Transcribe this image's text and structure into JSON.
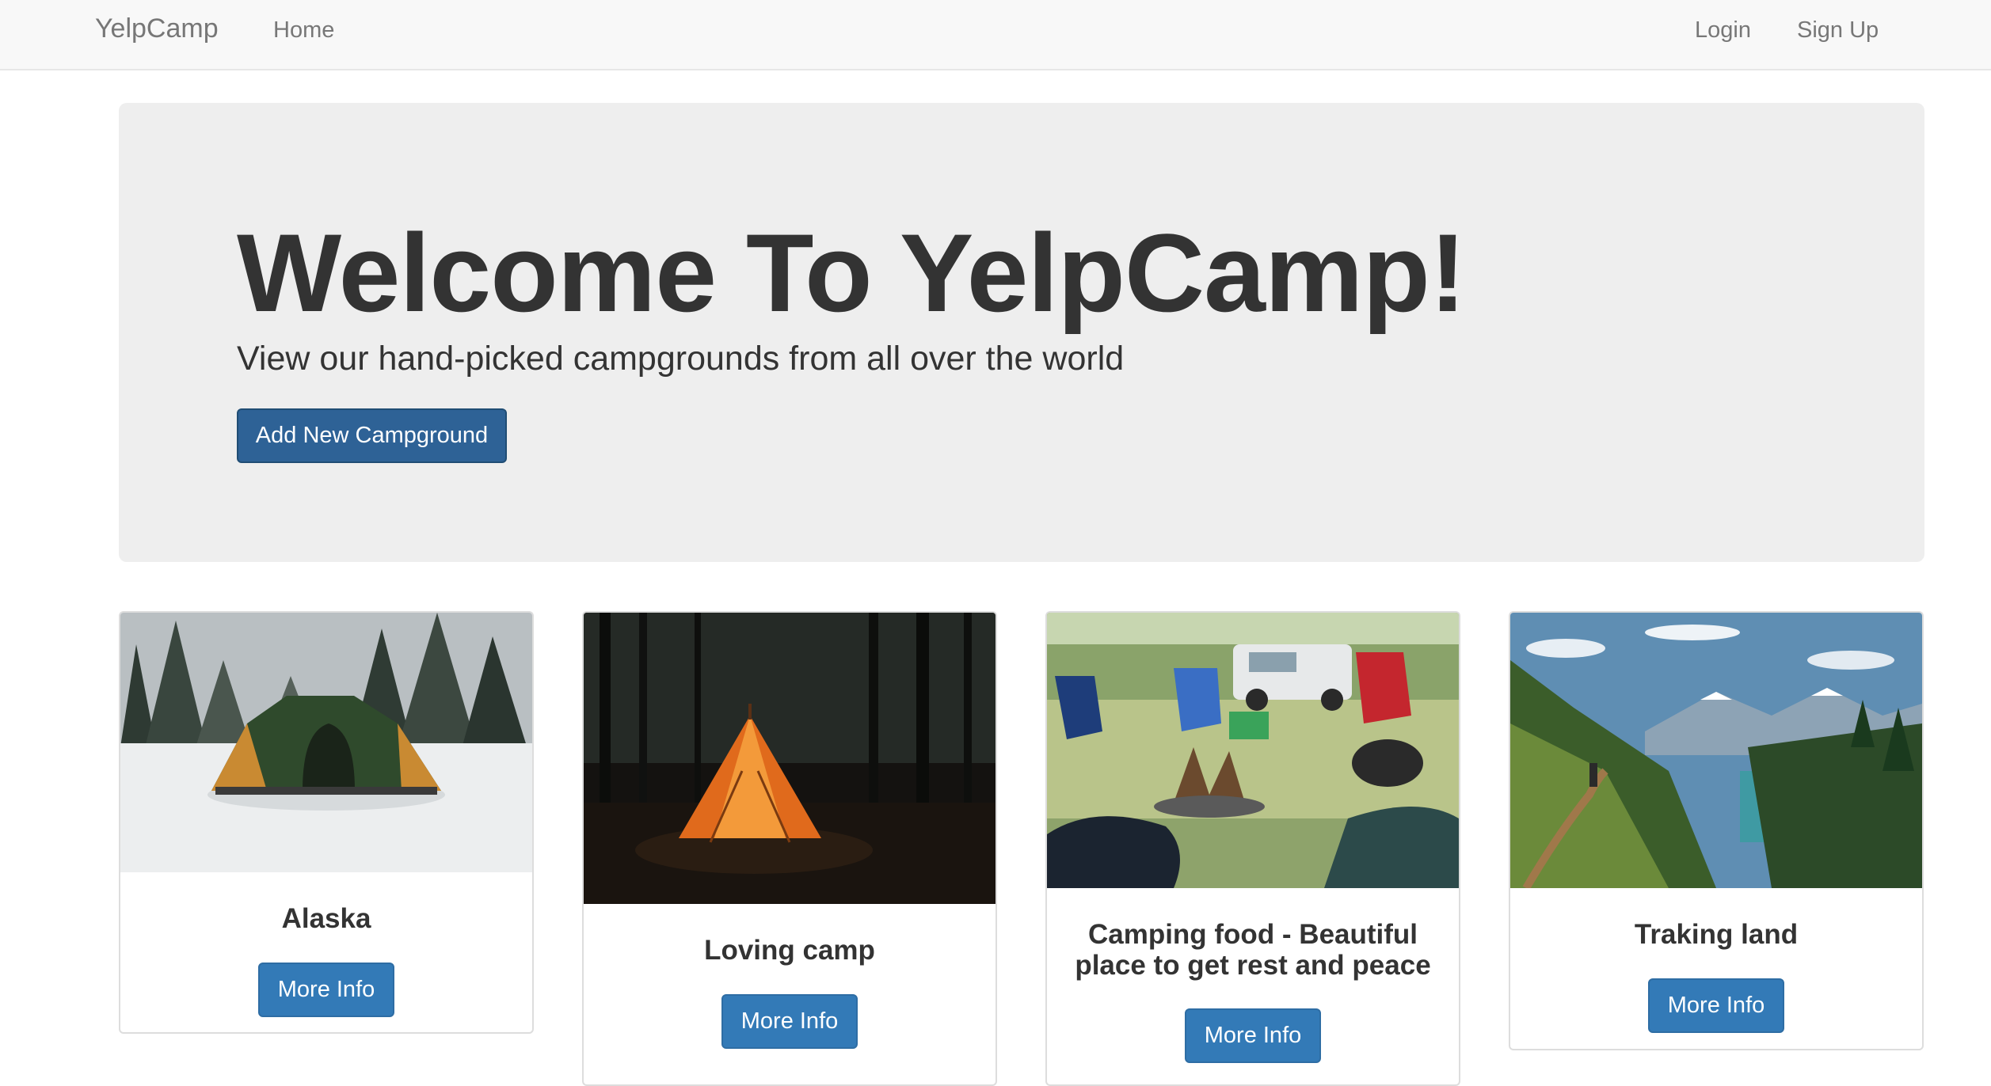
{
  "navbar": {
    "brand": "YelpCamp",
    "home": "Home",
    "login": "Login",
    "signup": "Sign Up"
  },
  "jumbotron": {
    "title": "Welcome To YelpCamp!",
    "subtitle": "View our hand-picked campgrounds from all over the world",
    "add_button": "Add New Campground"
  },
  "campgrounds": [
    {
      "name": "Alaska",
      "button": "More Info"
    },
    {
      "name": "Loving camp",
      "button": "More Info"
    },
    {
      "name": "Camping food - Beautiful place to get rest and peace",
      "button": "More Info"
    },
    {
      "name": "Traking land",
      "button": "More Info"
    }
  ],
  "colors": {
    "primary_button": "#337ab7",
    "dark_button": "#2e6296",
    "navbar_bg": "#f8f8f8",
    "jumbotron_bg": "#eeeeee"
  }
}
